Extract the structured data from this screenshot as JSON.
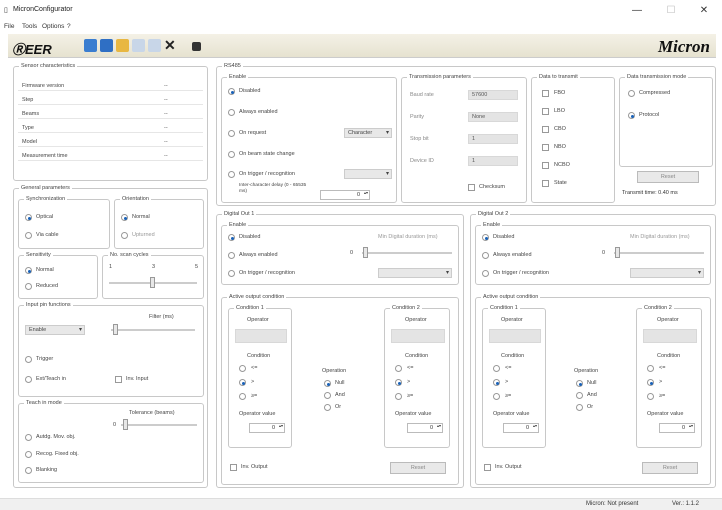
{
  "window": {
    "title": "MicronConfigurator",
    "minimize": "—",
    "maximize": "☐",
    "close": "✕"
  },
  "menu": [
    "File",
    "Tools",
    "Options",
    "?"
  ],
  "toolbar": {
    "logo_main": "EREER",
    "logo_r": "R",
    "brand": "Micron"
  },
  "sensor": {
    "title": "Sensor characteristics",
    "rows": [
      {
        "label": "Firmware version",
        "value": "--"
      },
      {
        "label": "Step",
        "value": "--"
      },
      {
        "label": "Beams",
        "value": "--"
      },
      {
        "label": "Type",
        "value": "--"
      },
      {
        "label": "Model",
        "value": "--"
      },
      {
        "label": "Measurement time",
        "value": "--"
      }
    ]
  },
  "general": {
    "title": "General parameters",
    "sync": {
      "title": "Synchronization",
      "optical": "Optical",
      "via_cable": "Via cable"
    },
    "orient": {
      "title": "Orientation",
      "normal": "Normal",
      "upturned": "Upturned"
    },
    "sensitivity": {
      "title": "Sensitivity",
      "normal": "Normal",
      "reduced": "Reduced"
    },
    "noscan": {
      "title": "No. scan cycles",
      "t1": "1",
      "t2": "3",
      "t3": "5"
    },
    "input": {
      "title": "Input pin functions",
      "filter": "Filter (ms)",
      "value": "Enable",
      "trigger": "Trigger",
      "ext": "Ext/Teach in",
      "inv": "Inv. Input"
    },
    "teach": {
      "title": "Teach in mode",
      "tol": "Tolerance (beams)",
      "tol_val": "0",
      "a": "Autdg. Mov. obj.",
      "b": "Recog. Fixed obj.",
      "c": "Blanking"
    }
  },
  "rs485": {
    "title": "RS485",
    "enable": "Enable",
    "opts": [
      "Disabled",
      "Always enabled",
      "On request",
      "On beam state change",
      "On trigger / recognition"
    ],
    "request_dd": "Character",
    "inter": "Inter-character delay (0 - 65535 ms)",
    "inter_val": "0",
    "tx": {
      "title": "Transmission parameters",
      "baud_l": "Baud rate",
      "baud": "57600",
      "parity_l": "Parity",
      "parity": "None",
      "stop_l": "Stop bit",
      "stop": "1",
      "dev_l": "Device ID",
      "dev": "1",
      "checksum": "Checksum"
    },
    "data": {
      "title": "Data to transmit",
      "items": [
        "FBO",
        "LBO",
        "CBO",
        "NBO",
        "NCBO",
        "State"
      ]
    },
    "mode": {
      "title": "Data transmission mode",
      "compressed": "Compressed",
      "protocol": "Protocol",
      "reset": "Reset",
      "time": "Transmit time: 0.40 ms"
    }
  },
  "dout1": {
    "title": "Digital Out 1",
    "enable": "Enable",
    "disabled": "Disabled",
    "always": "Always enabled",
    "trigger": "On trigger / recognition",
    "mindur": "Min Digital duration (ms)",
    "active": "Active output condition",
    "c1": "Condition 1",
    "c2": "Condition 2",
    "operator": "Operator",
    "condition": "Condition",
    "op_value": "Operator value",
    "operation": "Operation",
    "ops": [
      "Null",
      "And",
      "Or"
    ],
    "conds": [
      "<=",
      ">",
      "≥="
    ],
    "inv": "Inv. Output",
    "reset": "Reset",
    "val": "0"
  },
  "dout2": {
    "title": "Digital Out 2",
    "enable": "Enable",
    "disabled": "Disabled",
    "always": "Always enabled",
    "trigger": "On trigger / recognition",
    "mindur": "Min Digital duration (ms)",
    "active": "Active output condition",
    "c1": "Condition 1",
    "c2": "Condition 2",
    "operator": "Operator",
    "condition": "Condition",
    "op_value": "Operator value",
    "operation": "Operation",
    "ops": [
      "Null",
      "And",
      "Or"
    ],
    "conds": [
      "<=",
      ">",
      "≥="
    ],
    "inv": "Inv. Output",
    "reset": "Reset",
    "val": "0"
  },
  "status": {
    "text": "Micron: Not present",
    "version": "Ver.: 1.1.2"
  }
}
